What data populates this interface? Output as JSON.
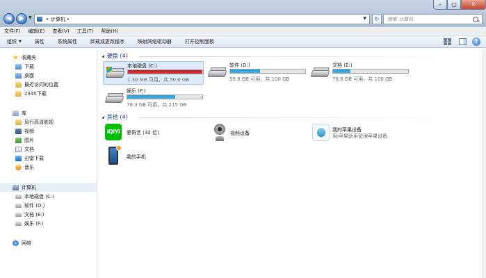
{
  "window": {
    "minimize": "–",
    "maximize": "□",
    "close": "✕"
  },
  "nav": {
    "back": "◀",
    "forward": "▶",
    "dropdown": "▼"
  },
  "address": {
    "sep1": "▸",
    "path": "计算机",
    "sep2": "▸",
    "dropdown": "▼",
    "refresh": "↻"
  },
  "search": {
    "placeholder": "搜索 计算机"
  },
  "menu": [
    "文件(F)",
    "编辑(E)",
    "查看(V)",
    "工具(T)",
    "帮助(H)"
  ],
  "toolbar": {
    "items": [
      "组织",
      "属性",
      "系统属性",
      "卸载或更改程序",
      "映射网络驱动器",
      "打开控制面板"
    ],
    "help": "?"
  },
  "sidebar": {
    "items": [
      {
        "label": "收藏夹",
        "icon": "star-icon"
      },
      {
        "label": "下载",
        "icon": "folder-icon"
      },
      {
        "label": "桌面",
        "icon": "folder-icon"
      },
      {
        "label": "最近访问的位置",
        "icon": "folder-icon"
      },
      {
        "label": "2345下载",
        "icon": "folder-icon"
      },
      {
        "label": "库",
        "icon": "library-icon"
      },
      {
        "label": "风行高清影视",
        "icon": "folder-icon"
      },
      {
        "label": "视频",
        "icon": "video-icon"
      },
      {
        "label": "图片",
        "icon": "picture-icon"
      },
      {
        "label": "文档",
        "icon": "document-icon"
      },
      {
        "label": "迅雷下载",
        "icon": "thunder-icon"
      },
      {
        "label": "音乐",
        "icon": "music-icon"
      },
      {
        "label": "计算机",
        "icon": "computer-icon"
      },
      {
        "label": "本地磁盘 (C:)",
        "icon": "drive-icon"
      },
      {
        "label": "软件 (D:)",
        "icon": "drive-icon"
      },
      {
        "label": "文档 (E:)",
        "icon": "drive-icon"
      },
      {
        "label": "娱乐 (F:)",
        "icon": "drive-icon"
      },
      {
        "label": "网络",
        "icon": "network-icon"
      }
    ]
  },
  "groups": {
    "drives_header": "硬盘 (4)",
    "other_header": "其他 (4)"
  },
  "drives": [
    {
      "name": "本地磁盘 (C:)",
      "info": "1.30 MB 可用，共 50.0 GB",
      "used_fraction": 0.99,
      "color": "#c8191e"
    },
    {
      "name": "软件 (D:)",
      "info": "59.8 GB 可用，共 100 GB",
      "used_fraction": 0.4,
      "color": "#26a0da"
    },
    {
      "name": "文档 (E:)",
      "info": "76.6 GB 可用，共 100 GB",
      "used_fraction": 0.23,
      "color": "#26a0da"
    },
    {
      "name": "娱乐 (F:)",
      "info": "78.3 GB 可用，共 215 GB",
      "used_fraction": 0.64,
      "color": "#26a0da"
    }
  ],
  "others": [
    {
      "name": "爱奇艺 (32 位)",
      "sub": "",
      "icon": "iqiyi-icon",
      "icon_text": "iQIYI"
    },
    {
      "name": "视频设备",
      "sub": "",
      "icon": "webcam-icon"
    },
    {
      "name": "我的苹果设备",
      "sub": "用i苹果助手管理苹果设备",
      "icon": "apple-device-icon"
    },
    {
      "name": "我的手机",
      "sub": "",
      "icon": "phone-icon"
    }
  ]
}
